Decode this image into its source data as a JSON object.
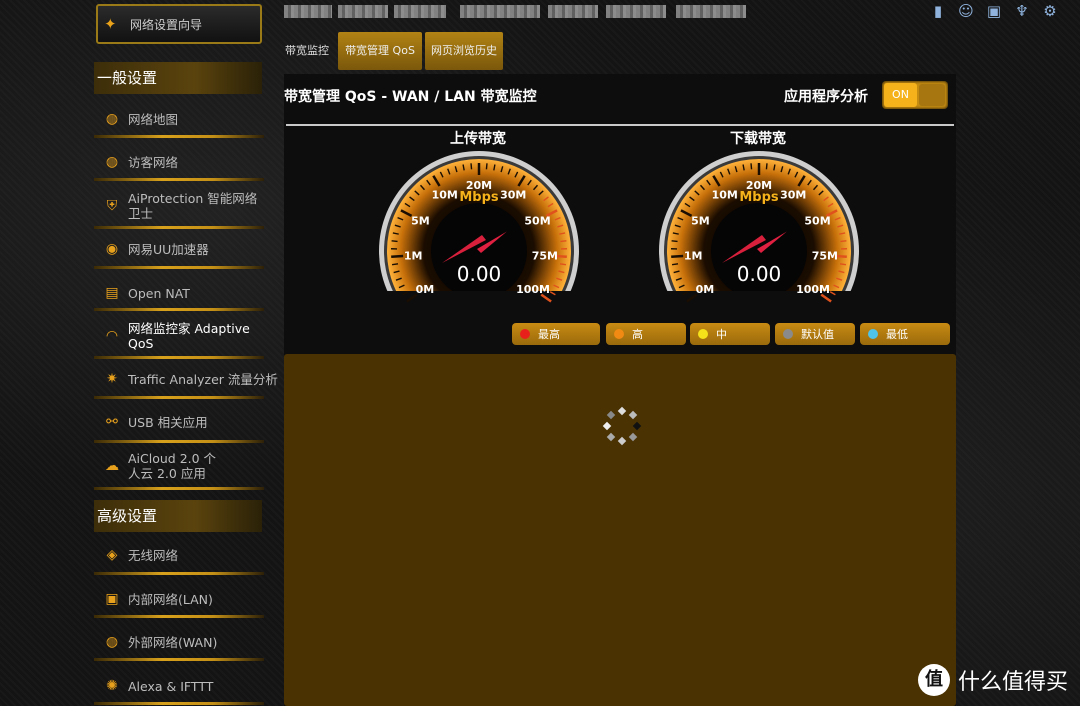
{
  "sidebar": {
    "wizard_label": "网络设置向导",
    "general_header": "一般设置",
    "advanced_header": "高级设置",
    "general_items": [
      {
        "label": "网络地图",
        "icon": "globe-icon"
      },
      {
        "label": "访客网络",
        "icon": "guest-globe-icon"
      },
      {
        "label": "AiProtection 智能网络卫士",
        "icon": "shield-lock-icon"
      },
      {
        "label": "网易UU加速器",
        "icon": "uu-accelerator-icon"
      },
      {
        "label": "Open NAT",
        "icon": "open-nat-icon"
      },
      {
        "label": "网络监控家 Adaptive QoS",
        "icon": "speedometer-icon"
      },
      {
        "label": "Traffic Analyzer 流量分析",
        "icon": "analyzer-icon"
      },
      {
        "label": "USB 相关应用",
        "icon": "usb-icon"
      },
      {
        "label": "AiCloud 2.0 个人云 2.0 应用",
        "icon": "cloud-icon"
      }
    ],
    "advanced_items": [
      {
        "label": "无线网络",
        "icon": "wireless-icon"
      },
      {
        "label": "内部网络(LAN)",
        "icon": "lan-icon"
      },
      {
        "label": "外部网络(WAN)",
        "icon": "wan-globe-icon"
      },
      {
        "label": "Alexa & IFTTT",
        "icon": "alexa-icon"
      }
    ]
  },
  "tabs": {
    "bandwidth_monitor": "带宽监控",
    "qos": "带宽管理 QoS",
    "history": "网页浏览历史"
  },
  "panel": {
    "title": "带宽管理 QoS - WAN / LAN 带宽监控",
    "app_analysis_label": "应用程序分析",
    "toggle_state": "ON"
  },
  "gauges": {
    "unit": "Mbps",
    "ticks": [
      "0M",
      "1M",
      "5M",
      "10M",
      "20M",
      "30M",
      "50M",
      "75M",
      "100M"
    ],
    "upload": {
      "title": "上传带宽",
      "value": "0.00"
    },
    "download": {
      "title": "下载带宽",
      "value": "0.00"
    }
  },
  "legend": [
    {
      "label": "最高",
      "color": "#e8201c"
    },
    {
      "label": "高",
      "color": "#f08a12"
    },
    {
      "label": "中",
      "color": "#f5e21a"
    },
    {
      "label": "默认值",
      "color": "#8a8a8a"
    },
    {
      "label": "最低",
      "color": "#4fc3e8"
    }
  ],
  "watermark": {
    "text": "什么值得买",
    "logo": "值"
  }
}
